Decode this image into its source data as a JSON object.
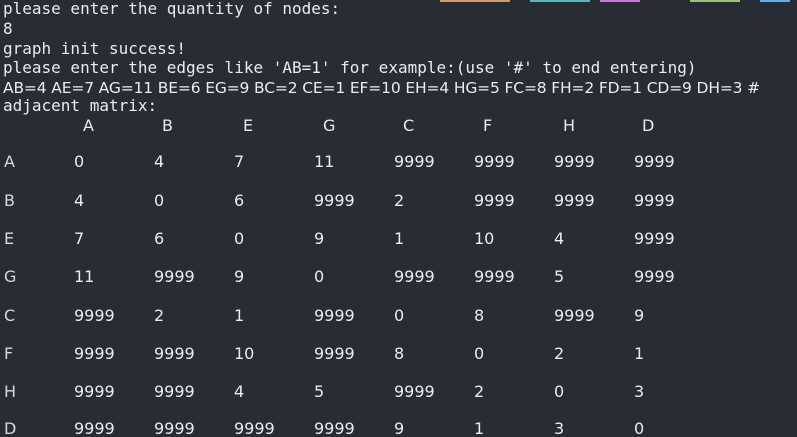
{
  "terminal": {
    "background": "#282c34",
    "foreground": "#e9ecf0",
    "top_edge_colors": [
      "#d19a66",
      "#56b6c2",
      "#c678dd",
      "#98c379",
      "#61afef"
    ],
    "lines": [
      "please enter the quantity of nodes:",
      "8",
      "graph init success!",
      "please enter the edges like 'AB=1' for example:(use '#' to end entering)",
      "AB=4 AE=7 AG=11 BE=6 EG=9 BC=2 CE=1 EF=10 EH=4 HG=5 FC=8 FH=2 FD=1 CD=9 DH=3 #",
      "adjacent matrix:"
    ],
    "matrix": {
      "column_headers": [
        "A",
        "B",
        "E",
        "G",
        "C",
        "F",
        "H",
        "D"
      ],
      "rows": [
        {
          "label": "A",
          "values": [
            "0",
            "4",
            "7",
            "11",
            "9999",
            "9999",
            "9999",
            "9999"
          ]
        },
        {
          "label": "B",
          "values": [
            "4",
            "0",
            "6",
            "9999",
            "2",
            "9999",
            "9999",
            "9999"
          ]
        },
        {
          "label": "E",
          "values": [
            "7",
            "6",
            "0",
            "9",
            "1",
            "10",
            "4",
            "9999"
          ]
        },
        {
          "label": "G",
          "values": [
            "11",
            "9999",
            "9",
            "0",
            "9999",
            "9999",
            "5",
            "9999"
          ]
        },
        {
          "label": "C",
          "values": [
            "9999",
            "2",
            "1",
            "9999",
            "0",
            "8",
            "9999",
            "9"
          ]
        },
        {
          "label": "F",
          "values": [
            "9999",
            "9999",
            "10",
            "9999",
            "8",
            "0",
            "2",
            "1"
          ]
        },
        {
          "label": "H",
          "values": [
            "9999",
            "9999",
            "4",
            "5",
            "9999",
            "2",
            "0",
            "3"
          ]
        },
        {
          "label": "D",
          "values": [
            "9999",
            "9999",
            "9999",
            "9999",
            "9",
            "1",
            "3",
            "0"
          ]
        }
      ]
    }
  }
}
